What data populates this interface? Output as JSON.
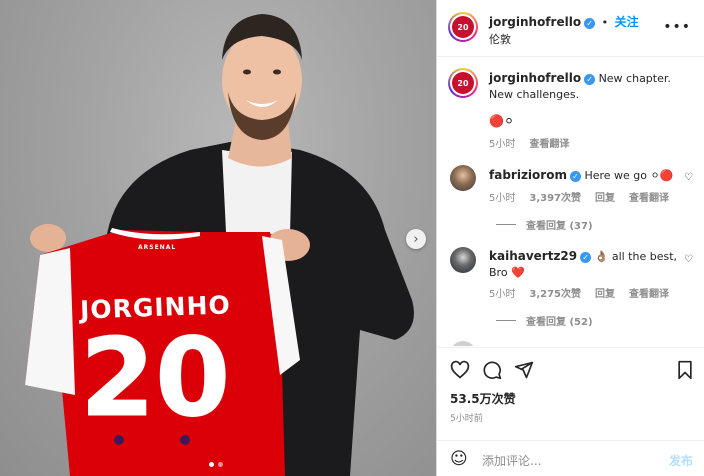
{
  "photo": {
    "jersey_name": "JORGINHO",
    "jersey_number": "20",
    "jersey_brand": "ARSENAL",
    "carousel_dots": 2,
    "active_dot": 0
  },
  "header": {
    "username": "jorginhofrello",
    "follow_label": "关注",
    "location": "伦敦",
    "avatar_text": "20"
  },
  "caption": {
    "username": "jorginhofrello",
    "text": "New chapter. New challenges.",
    "emoji_text": "🔴⚪",
    "time": "5小时",
    "translate": "查看翻译"
  },
  "comments": [
    {
      "username": "fabriziorom",
      "text": "Here we go ⚪🔴",
      "time": "5小时",
      "likes": "3,397次赞",
      "reply": "回复",
      "translate": "查看翻译",
      "view_replies": "查看回复 (37)"
    },
    {
      "username": "kaihavertz29",
      "text": "👌🏽 all the best, Bro ❤️",
      "time": "5小时",
      "likes": "3,275次赞",
      "reply": "回复",
      "translate": "查看翻译",
      "view_replies": "查看回复 (52)"
    }
  ],
  "stats": {
    "likes": "53.5万次赞",
    "time": "5小时前"
  },
  "add_comment": {
    "placeholder": "添加评论...",
    "post_label": "发布"
  },
  "colors": {
    "accent": "#0095f6",
    "verified": "#3897f0",
    "arsenal_red": "#db0007"
  }
}
